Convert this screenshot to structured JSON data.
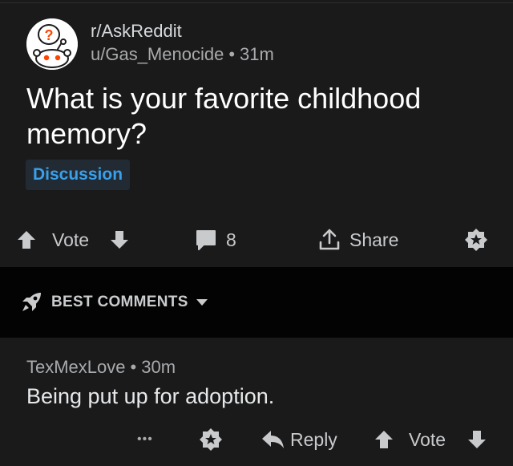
{
  "post": {
    "subreddit": "r/AskReddit",
    "author": "u/Gas_Menocide",
    "separator": "•",
    "age": "31m",
    "title": "What is your favorite childhood memory?",
    "flair": "Discussion",
    "actions": {
      "vote_label": "Vote",
      "comment_count": "8",
      "share_label": "Share"
    }
  },
  "sort": {
    "label": "BEST COMMENTS"
  },
  "comment": {
    "author": "TexMexLove",
    "separator": "•",
    "age": "30m",
    "body": "Being put up for adoption.",
    "more_label": "•••",
    "reply_label": "Reply",
    "vote_label": "Vote"
  },
  "colors": {
    "background": "#1a1a1b",
    "divider_band": "#030303",
    "flair_text": "#3aa0ea",
    "avatar_accent": "#ff4500"
  },
  "icons": {
    "avatar": "askreddit-snoo-avatar",
    "upvote": "arrow-up-icon",
    "downvote": "arrow-down-icon",
    "comment": "comment-bubble-icon",
    "share": "share-icon",
    "award": "award-icon",
    "sort": "rocket-icon",
    "dropdown": "caret-down-icon",
    "reply": "reply-arrow-icon"
  }
}
